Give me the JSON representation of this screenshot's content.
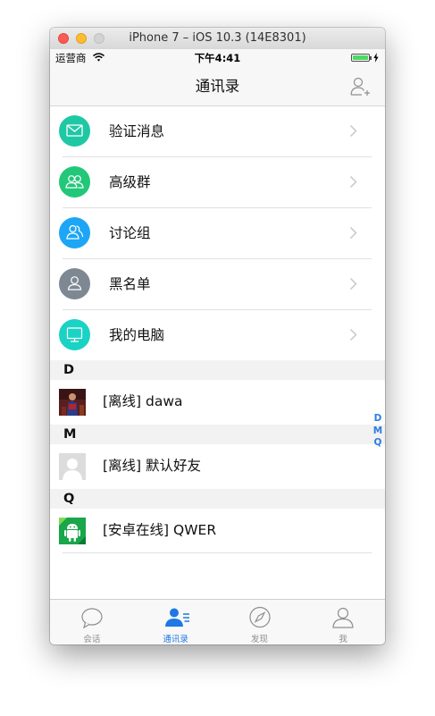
{
  "window": {
    "title": "iPhone 7 – iOS 10.3 (14E8301)"
  },
  "status_bar": {
    "carrier": "运营商",
    "time": "下午4:41",
    "battery_level": 1.0
  },
  "nav_bar": {
    "title": "通讯录",
    "right_icon": "add-friend-icon"
  },
  "menu": [
    {
      "label": "验证消息",
      "icon": "mail-icon",
      "color": "#1fc8a5"
    },
    {
      "label": "高级群",
      "icon": "group-icon",
      "color": "#22c77a"
    },
    {
      "label": "讨论组",
      "icon": "discussion-icon",
      "color": "#1da6f5"
    },
    {
      "label": "黑名单",
      "icon": "person-icon",
      "color": "#7d8893"
    },
    {
      "label": "我的电脑",
      "icon": "monitor-icon",
      "color": "#1ad3c4"
    }
  ],
  "contacts": [
    {
      "section": "D",
      "name": "[离线] dawa",
      "avatar": "photo"
    },
    {
      "section": "M",
      "name": "[离线] 默认好友",
      "avatar": "default-avatar"
    },
    {
      "section": "Q",
      "name": "[安卓在线] QWER",
      "avatar": "android-avatar"
    }
  ],
  "index_letters": [
    "D",
    "M",
    "Q"
  ],
  "tabs": [
    {
      "label": "会话",
      "icon": "chat-bubble-icon",
      "active": false
    },
    {
      "label": "通讯录",
      "icon": "contacts-icon",
      "active": true
    },
    {
      "label": "发现",
      "icon": "compass-icon",
      "active": false
    },
    {
      "label": "我",
      "icon": "profile-icon",
      "active": false
    }
  ],
  "colors": {
    "accent": "#1e78e4",
    "index": "#2b7de1"
  }
}
